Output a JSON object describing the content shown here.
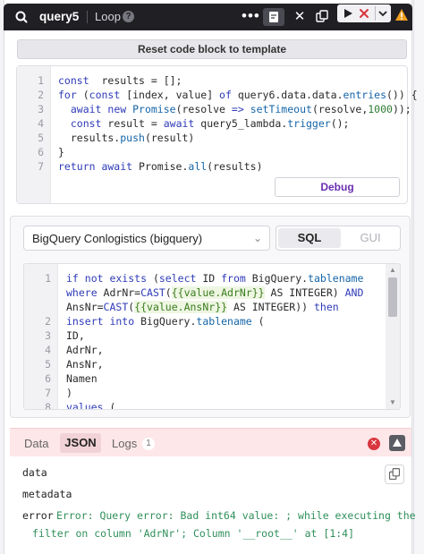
{
  "header": {
    "query_name": "query5",
    "loop_label": "Loop",
    "help_glyph": "?",
    "more_glyph": "•••",
    "close_glyph": "✕",
    "icons": [
      "query-icon",
      "note-icon",
      "close-icon",
      "copy-icon",
      "play-icon",
      "stop-icon",
      "chevron-down-icon",
      "warning-icon"
    ]
  },
  "reset_button": {
    "label": "Reset code block to template"
  },
  "js_editor": {
    "lines": [
      {
        "n": "1",
        "segs": [
          [
            "kw",
            "const"
          ],
          [
            "",
            "  results = [];"
          ]
        ]
      },
      {
        "n": "2",
        "segs": [
          [
            "kw",
            "for"
          ],
          [
            "",
            " ("
          ],
          [
            "kw",
            "const"
          ],
          [
            "",
            " [index, value] "
          ],
          [
            "kw",
            "of"
          ],
          [
            "",
            " query6.data.data."
          ],
          [
            "fn",
            "entries"
          ],
          [
            "",
            "()) {"
          ]
        ]
      },
      {
        "n": "3",
        "segs": [
          [
            "",
            "  "
          ],
          [
            "kw",
            "await new"
          ],
          [
            "",
            " "
          ],
          [
            "fn",
            "Promise"
          ],
          [
            "",
            "(resolve "
          ],
          [
            "kw",
            "=>"
          ],
          [
            "",
            " "
          ],
          [
            "fn",
            "setTimeout"
          ],
          [
            "",
            "(resolve,"
          ],
          [
            "num",
            "1000"
          ],
          [
            "",
            "));"
          ]
        ]
      },
      {
        "n": "4",
        "segs": [
          [
            "",
            "  "
          ],
          [
            "kw",
            "const"
          ],
          [
            "",
            " result = "
          ],
          [
            "kw",
            "await"
          ],
          [
            "",
            " query5_lambda."
          ],
          [
            "fn",
            "trigger"
          ],
          [
            "",
            "();"
          ]
        ]
      },
      {
        "n": "5",
        "segs": [
          [
            "",
            "  results."
          ],
          [
            "fn",
            "push"
          ],
          [
            "",
            "(result)"
          ]
        ]
      },
      {
        "n": "6",
        "segs": [
          [
            "",
            "}"
          ]
        ]
      },
      {
        "n": "7",
        "segs": [
          [
            "kw",
            "return await"
          ],
          [
            "",
            " Promise."
          ],
          [
            "fn",
            "all"
          ],
          [
            "",
            "(results)"
          ]
        ]
      }
    ],
    "debug_label": "Debug"
  },
  "datasource": {
    "selected": "BigQuery Conlogistics (bigquery)",
    "chevron_glyph": "⌄",
    "modes": {
      "sql": "SQL",
      "gui": "GUI"
    }
  },
  "sql_editor": {
    "scroll_up_glyph": "▲",
    "scroll_down_glyph": "▼",
    "lines": [
      {
        "n": "1",
        "segs": [
          [
            "kw",
            "if not exists"
          ],
          [
            "",
            " ("
          ],
          [
            "kw",
            "select"
          ],
          [
            "",
            " ID "
          ],
          [
            "kw",
            "from"
          ],
          [
            "",
            " BigQuery."
          ],
          [
            "fn",
            "tablename"
          ]
        ]
      },
      {
        "n": "",
        "segs": [
          [
            "kw",
            "where"
          ],
          [
            "",
            " AdrNr="
          ],
          [
            "kw",
            "CAST"
          ],
          [
            "",
            "("
          ],
          [
            "tmpl",
            "{{value.AdrNr}}"
          ],
          [
            "",
            " AS INTEGER) "
          ],
          [
            "kw",
            "AND"
          ]
        ]
      },
      {
        "n": "",
        "segs": [
          [
            "",
            "AnsNr="
          ],
          [
            "kw",
            "CAST"
          ],
          [
            "",
            "("
          ],
          [
            "tmpl",
            "{{value.AnsNr}}"
          ],
          [
            "",
            " AS INTEGER)) "
          ],
          [
            "kw",
            "then"
          ]
        ]
      },
      {
        "n": "2",
        "segs": [
          [
            "kw",
            "insert into"
          ],
          [
            "",
            " BigQuery."
          ],
          [
            "fn",
            "tablename"
          ],
          [
            "",
            " ("
          ]
        ]
      },
      {
        "n": "3",
        "segs": [
          [
            "",
            "ID,"
          ]
        ]
      },
      {
        "n": "4",
        "segs": [
          [
            "",
            "AdrNr,"
          ]
        ]
      },
      {
        "n": "5",
        "segs": [
          [
            "",
            "AnsNr,"
          ]
        ]
      },
      {
        "n": "6",
        "segs": [
          [
            "",
            "Namen"
          ]
        ]
      },
      {
        "n": "7",
        "segs": [
          [
            "",
            ")"
          ]
        ]
      },
      {
        "n": "8",
        "segs": [
          [
            "kw",
            "values"
          ],
          [
            "",
            " ("
          ]
        ]
      }
    ]
  },
  "results": {
    "tabs": {
      "data": "Data",
      "json": "JSON",
      "logs": "Logs"
    },
    "logs_count": "1",
    "error_glyph": "✕",
    "data_key": "data",
    "metadata_key": "metadata",
    "error_key": "error",
    "error_line1": "Error: Query error: Bad int64 value: ; while executing the",
    "error_line2": "filter on column 'AdrNr'; Column '__root__' at [1:4]"
  },
  "colors": {
    "header_bg": "#1f1f24",
    "accent_purple": "#6a2fb0",
    "error_red": "#d9363e",
    "result_bar_bg": "#fde7e9",
    "warning_orange": "#f0a020",
    "error_text_green": "#2f8f5a"
  }
}
